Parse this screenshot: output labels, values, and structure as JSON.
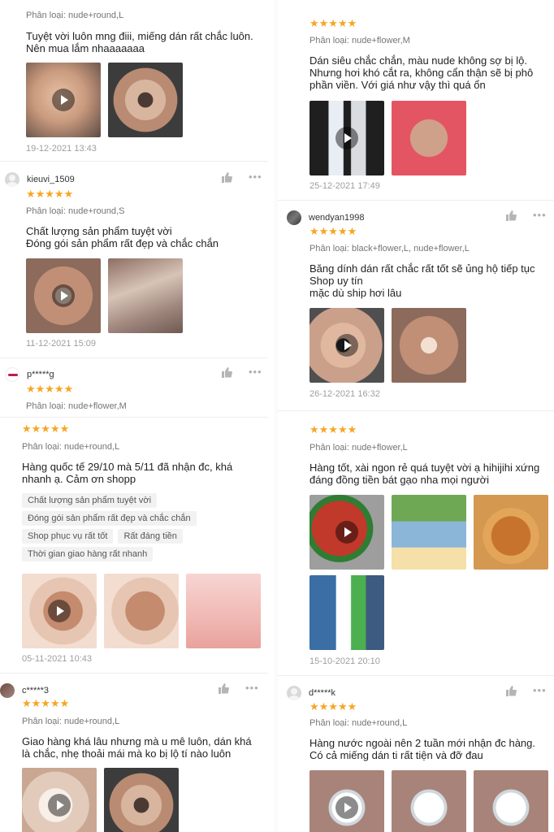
{
  "left": [
    {
      "variant": "Phân loại: nude+round,L",
      "comment": [
        "Tuyệt vời luôn mng điii, miếng dán rất chắc luôn.",
        "Nên mua lắm nhaaaaaaa"
      ],
      "date": "19-12-2021 13:43",
      "stars": "★★★★★"
    },
    {
      "user": "kieuvi_1509",
      "variant": "Phân loại: nude+round,S",
      "comment": [
        "Chất lượng sản phẩm tuyệt vời",
        "Đóng gói sản phẩm rất đẹp và chắc chắn"
      ],
      "date": "11-12-2021 15:09",
      "stars": "★★★★★"
    },
    {
      "user": "p*****g",
      "variant": "Phân loại: nude+flower,M",
      "stars": "★★★★★"
    },
    {
      "variant": "Phân loại: nude+round,L",
      "comment": [
        "Hàng quốc tế 29/10 mà 5/11 đã nhận đc, khá",
        "nhanh ạ. Cảm ơn shopp"
      ],
      "tags": [
        "Chất lượng sản phẩm tuyệt vời",
        "Đóng gói sản phẩm rất đẹp và chắc chắn",
        "Shop phục vụ rất tốt",
        "Rất đáng tiền",
        "Thời gian giao hàng rất nhanh"
      ],
      "date": "05-11-2021 10:43",
      "stars": "★★★★★"
    },
    {
      "user": "c*****3",
      "variant": "Phân loại: nude+round,L",
      "comment": [
        "Giao hàng khá lâu nhưng mà u mê luôn, dán khá",
        "là chắc, nhẹ thoải mái mà ko bị lộ tí nào luôn"
      ],
      "stars": "★★★★★"
    }
  ],
  "right": [
    {
      "variant": "Phân loại: nude+flower,M",
      "comment": [
        "Dán siêu chắc chắn,  màu nude không sợ bị lộ.",
        "Nhưng hơi khó cắt ra, không cẩn thận sẽ bị phô",
        "phần viền.  Với giá như vậy thì quá ổn"
      ],
      "date": "25-12-2021 17:49",
      "stars": "★★★★★"
    },
    {
      "user": "wendyan1998",
      "variant": "Phân loại: black+flower,L, nude+flower,L",
      "comment": [
        "Băng dính dán rất chắc rất tốt sẽ ủng hộ tiếp tục",
        "Shop uy tín",
        "mặc dù ship hơi lâu"
      ],
      "date": "26-12-2021 16:32",
      "stars": "★★★★★"
    },
    {
      "variant": "Phân loại: nude+flower,L",
      "comment": [
        "Hàng tốt, xài ngon rẻ quá tuyệt vời ạ hihijihi xứng",
        "đáng đồng tiền bát gạo nha mọi người"
      ],
      "date": "15-10-2021 20:10",
      "stars": "★★★★★"
    },
    {
      "user": "d*****k",
      "variant": "Phân loại: nude+round,L",
      "comment": [
        "Hàng nước ngoài nên 2 tuần mới nhận đc hàng.",
        "Có cả miếng dán ti rất tiện và đỡ đau"
      ],
      "stars": "★★★★★"
    }
  ],
  "icons": {
    "like": "👍",
    "more": "•••"
  },
  "colors": {
    "star": "#f6a623",
    "muted": "#9e9e9e"
  }
}
